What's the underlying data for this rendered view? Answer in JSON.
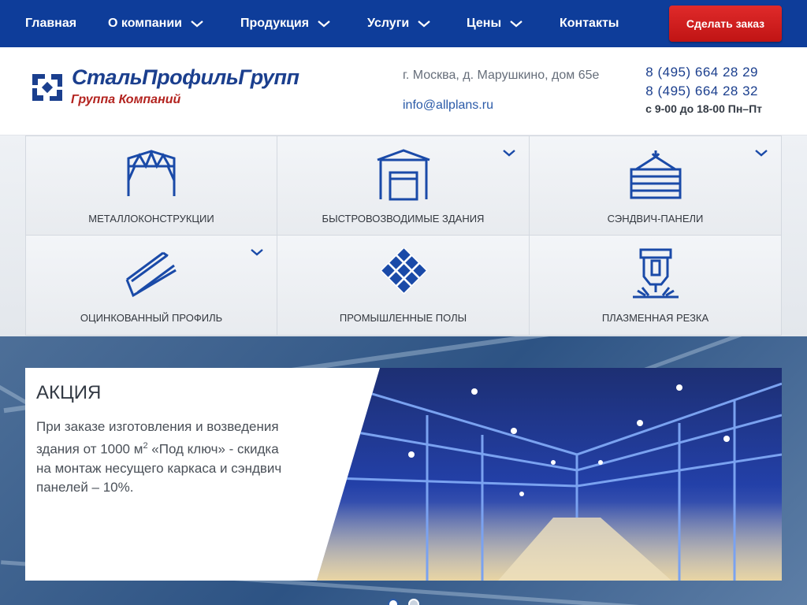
{
  "nav": {
    "items": [
      {
        "label": "Главная",
        "has_dropdown": false
      },
      {
        "label": "О компании",
        "has_dropdown": true
      },
      {
        "label": "Продукция",
        "has_dropdown": true
      },
      {
        "label": "Услуги",
        "has_dropdown": true
      },
      {
        "label": "Цены",
        "has_dropdown": true
      },
      {
        "label": "Контакты",
        "has_dropdown": false
      }
    ],
    "order_button": "Сделать заказ"
  },
  "header": {
    "logo_title": "СтальПрофильГрупп",
    "logo_subtitle": "Группа Компаний",
    "address": "г. Москва, д. Марушкино, дом 65е",
    "email": "info@allplans.ru",
    "phone1": "8 (495) 664 28 29",
    "phone2": "8 (495) 664 28 32",
    "hours": "с 9-00 до 18-00 Пн–Пт"
  },
  "products": [
    {
      "label": "Металлоконструкции",
      "icon": "frame-icon",
      "has_dropdown": false
    },
    {
      "label": "Быстровозводимые здания",
      "icon": "hangar-icon",
      "has_dropdown": true
    },
    {
      "label": "Сэндвич-панели",
      "icon": "panel-hook-icon",
      "has_dropdown": true
    },
    {
      "label": "Оцинкованный профиль",
      "icon": "profile-icon",
      "has_dropdown": true
    },
    {
      "label": "Промышленные полы",
      "icon": "floor-tiles-icon",
      "has_dropdown": false
    },
    {
      "label": "Плазменная резка",
      "icon": "plasma-cutter-icon",
      "has_dropdown": false
    }
  ],
  "promo": {
    "title": "АКЦИЯ",
    "text_before": "При заказе изготовления и возведения здания от 1000 м",
    "text_sup": "2",
    "text_after": " «Под ключ» - скидка на монтаж несущего каркаса и сэндвич панелей – 10%."
  },
  "slider": {
    "dots": 2,
    "active": 0
  },
  "colors": {
    "nav_bg": "#0e3d9a",
    "accent_red": "#c01414",
    "brand_blue": "#1b3f8e",
    "icon_blue": "#1a4aa8"
  }
}
